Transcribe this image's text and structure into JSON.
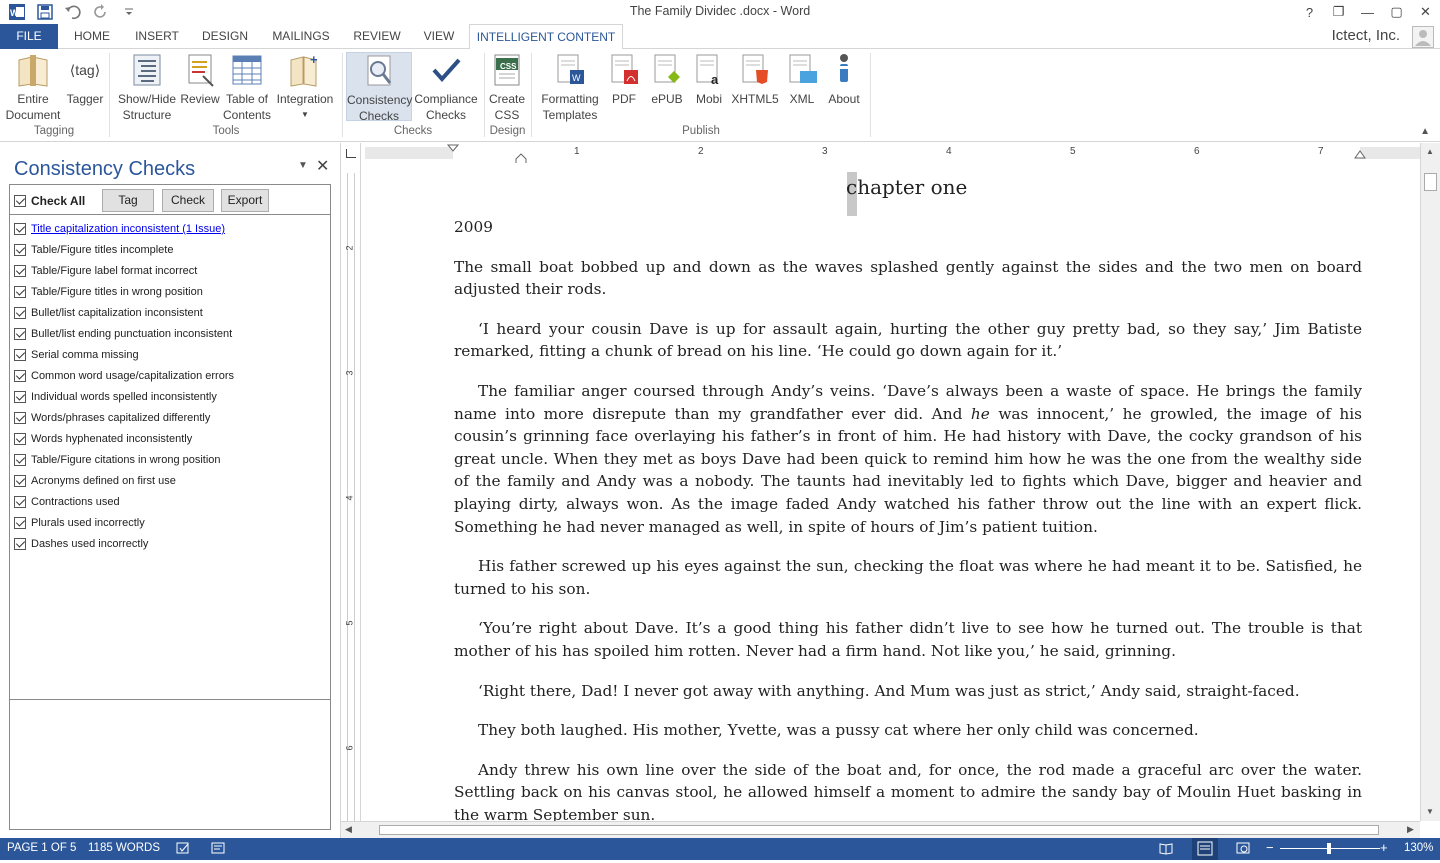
{
  "window": {
    "title": "The Family Dividec .docx - Word",
    "controls": [
      "?",
      "❐",
      "—",
      "▢",
      "✕"
    ]
  },
  "tabs": {
    "file": "FILE",
    "home": "HOME",
    "insert": "INSERT",
    "design": "DESIGN",
    "mailings": "MAILINGS",
    "review": "REVIEW",
    "view": "VIEW",
    "intelligent_content": "INTELLIGENT CONTENT"
  },
  "account": "Ictect, Inc.",
  "ribbon": {
    "groups": {
      "tagging": "Tagging",
      "tools": "Tools",
      "checks": "Checks",
      "design": "Design",
      "publish": "Publish"
    },
    "buttons": {
      "entire_document": [
        "Entire",
        "Document"
      ],
      "tagger": [
        "Tagger"
      ],
      "show_hide": [
        "Show/Hide",
        "Structure"
      ],
      "review": [
        "Review"
      ],
      "toc": [
        "Table of",
        "Contents"
      ],
      "integration": [
        "Integration"
      ],
      "consistency": [
        "Consistency",
        "Checks"
      ],
      "compliance": [
        "Compliance",
        "Checks"
      ],
      "create_css": [
        "Create",
        "CSS"
      ],
      "formatting": [
        "Formatting",
        "Templates"
      ],
      "pdf": [
        "PDF"
      ],
      "epub": [
        "ePUB"
      ],
      "mobi": [
        "Mobi"
      ],
      "xhtml5": [
        "XHTML5"
      ],
      "xml": [
        "XML"
      ],
      "about": [
        "About"
      ]
    },
    "tagger_icon_text": "⟨tag⟩",
    "css_icon_text": "CSS"
  },
  "pane": {
    "title": "Consistency Checks",
    "check_all": "Check All",
    "buttons": {
      "tag": "Tag",
      "check": "Check",
      "export": "Export"
    },
    "items": [
      "Title capitalization inconsistent (1 Issue)",
      "Table/Figure titles incomplete",
      "Table/Figure label format incorrect",
      "Table/Figure titles in wrong position",
      "Bullet/list capitalization inconsistent",
      "Bullet/list ending punctuation inconsistent",
      "Serial comma missing",
      "Common word usage/capitalization errors",
      "Individual words spelled inconsistently",
      "Words/phrases capitalized differently",
      "Words hyphenated inconsistently",
      "Table/Figure citations in wrong position",
      "Acronyms defined on first use",
      "Contractions used",
      "Plurals used incorrectly",
      "Dashes used incorrectly"
    ]
  },
  "ruler": {
    "h_numbers": [
      "1",
      "2",
      "3",
      "4",
      "5",
      "6",
      "7"
    ],
    "v_numbers": [
      "2",
      "3",
      "4",
      "5",
      "6"
    ]
  },
  "document": {
    "chapter": "chapter one",
    "year": "2009",
    "p1": "The small boat bobbed up and down as the waves splashed gently against the sides and the two men on board adjusted their rods.",
    "p2": "‘I heard your cousin Dave is up for assault again, hurting the other guy pretty bad, so they say,’ Jim Batiste remarked, fitting a chunk of bread on his line. ‘He could go down again for it.’",
    "p3a": "The familiar anger coursed through Andy’s veins. ‘Dave’s always been a waste of space. He brings the family name into more disrepute than my grandfather ever did. And ",
    "p3em": "he",
    "p3b": " was innocent,’ he growled, the image of his cousin’s grinning face overlaying his father’s in front of him. He had history with Dave, the cocky grandson of his great uncle. When they met as boys Dave had been quick to remind him how he was the one from the wealthy side of the family and Andy was a nobody. The taunts had inevitably led to fights which Dave, bigger and heavier and playing dirty, always won. As the image faded Andy watched his father throw out the line with an expert flick. Something he had never managed as well, in spite of hours of Jim’s patient tuition.",
    "p4": "His father screwed up his eyes against the sun, checking the float was where he had meant it to be. Satisfied, he turned to his son.",
    "p5": "‘You’re right about Dave. It’s a good thing his father didn’t live to see how he turned out. The trouble is that mother of his has spoiled him rotten. Never had a firm hand. Not like you,’ he said, grinning.",
    "p6": "‘Right there, Dad! I never got away with anything. And Mum was just as strict,’ Andy said, straight-faced.",
    "p7": "They both laughed. His mother, Yvette, was a pussy cat where her only child was concerned.",
    "p8": "Andy threw his own line over the side of the boat and, for once, the rod made a graceful arc over the water. Settling back on his canvas stool, he allowed himself a moment to admire the sandy bay of Moulin Huet basking in the warm September sun."
  },
  "status": {
    "page": "PAGE 1 OF 5",
    "words": "1185 WORDS",
    "zoom": "130%"
  },
  "colors": {
    "accent": "#2b579a"
  }
}
